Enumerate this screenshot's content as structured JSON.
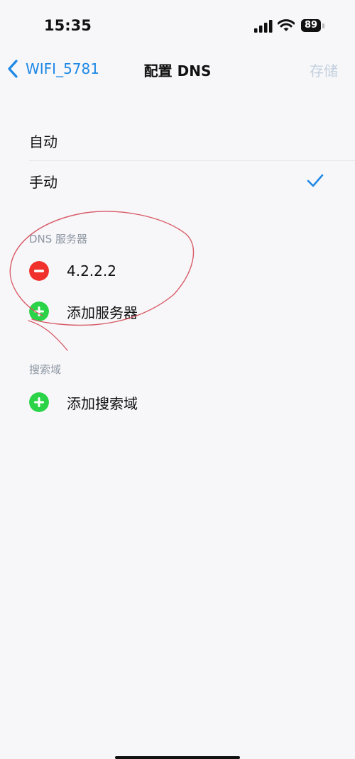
{
  "status_bar": {
    "time": "15:35",
    "battery": "89",
    "signal_icon": "cellular-signal-icon",
    "wifi_icon": "wifi-icon"
  },
  "nav": {
    "back_label": "WIFI_5781",
    "title": "配置 DNS",
    "save_label": "存储"
  },
  "mode_options": [
    {
      "label": "自动",
      "selected": false
    },
    {
      "label": "手动",
      "selected": true
    }
  ],
  "dns_section": {
    "header": "DNS 服务器",
    "servers": [
      "4.2.2.2"
    ],
    "add_label": "添加服务器"
  },
  "search_section": {
    "header": "搜索域",
    "add_label": "添加搜索域"
  },
  "colors": {
    "accent": "#1e88e5",
    "remove": "#f0302a",
    "add": "#2ad347",
    "annotation": "#d85a66"
  }
}
